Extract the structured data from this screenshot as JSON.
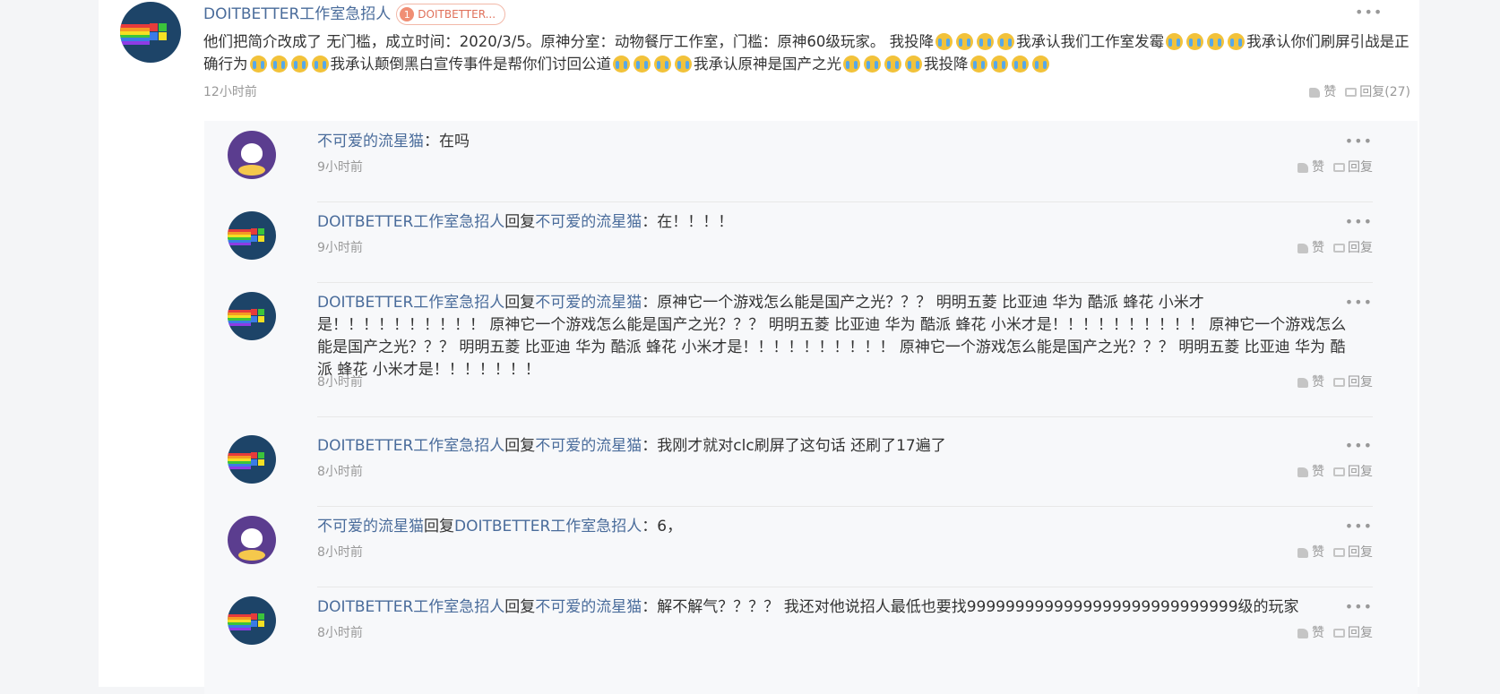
{
  "main_comment": {
    "username": "DOITBETTER工作室急招人",
    "badge_level": "1",
    "badge_text": "DOITBETTER...",
    "text_parts": [
      "他们把简介改成了 无门槛，成立时间：2020/3/5。原神分室：动物餐厅工作室，门槛：原神60级玩家。 我投降",
      "我承认我们工作室发霉",
      "我承认你们刷屏引战是正确行为",
      "我承认颠倒黑白宣传事件是帮你们讨回公道",
      "我承认原神是国产之光",
      "我投降"
    ],
    "emoji_name": "crying-face-emoji",
    "time": "12小时前",
    "like_label": "赞",
    "reply_label": "回复(27)"
  },
  "replies": [
    {
      "avatar": "cat",
      "author": "不可爱的流星猫",
      "reply_word": "",
      "target": "",
      "text": "：在吗",
      "time": "9小时前",
      "like_label": "赞",
      "reply_label": "回复"
    },
    {
      "avatar": "doit",
      "author": "DOITBETTER工作室急招人",
      "reply_word": "回复",
      "target": "不可爱的流星猫",
      "text": "：在！！！！",
      "time": "9小时前",
      "like_label": "赞",
      "reply_label": "回复"
    },
    {
      "avatar": "doit",
      "author": "DOITBETTER工作室急招人",
      "reply_word": "回复",
      "target": "不可爱的流星猫",
      "text": "：原神它一个游戏怎么能是国产之光？？？ 明明五菱 比亚迪 华为 酷派 蜂花 小米才是！！！！！！！！！！ 原神它一个游戏怎么能是国产之光？？？ 明明五菱 比亚迪 华为 酷派 蜂花 小米才是！！！！！！！！！！ 原神它一个游戏怎么能是国产之光？？？ 明明五菱 比亚迪 华为 酷派 蜂花 小米才是！！！！！！！！！！ 原神它一个游戏怎么能是国产之光？？？ 明明五菱 比亚迪 华为 酷派 蜂花 小米才是！！！！！！！",
      "time": "8小时前",
      "like_label": "赞",
      "reply_label": "回复"
    },
    {
      "avatar": "doit",
      "author": "DOITBETTER工作室急招人",
      "reply_word": "回复",
      "target": "不可爱的流星猫",
      "text": "：我刚才就对clc刷屏了这句话 还刷了17遍了",
      "time": "8小时前",
      "like_label": "赞",
      "reply_label": "回复"
    },
    {
      "avatar": "cat",
      "author": "不可爱的流星猫",
      "reply_word": "回复",
      "target": "DOITBETTER工作室急招人",
      "text": "：6，",
      "time": "8小时前",
      "like_label": "赞",
      "reply_label": "回复"
    },
    {
      "avatar": "doit",
      "author": "DOITBETTER工作室急招人",
      "reply_word": "回复",
      "target": "不可爱的流星猫",
      "text": "：解不解气？？？？ 我还对他说招人最低也要找9999999999999999999999999999级的玩家",
      "time": "8小时前",
      "like_label": "赞",
      "reply_label": "回复"
    }
  ],
  "colors": {
    "link": "#4a6c9b",
    "badge": "#e0705a",
    "time": "#999999",
    "reply_bg": "#f7f8fa"
  }
}
